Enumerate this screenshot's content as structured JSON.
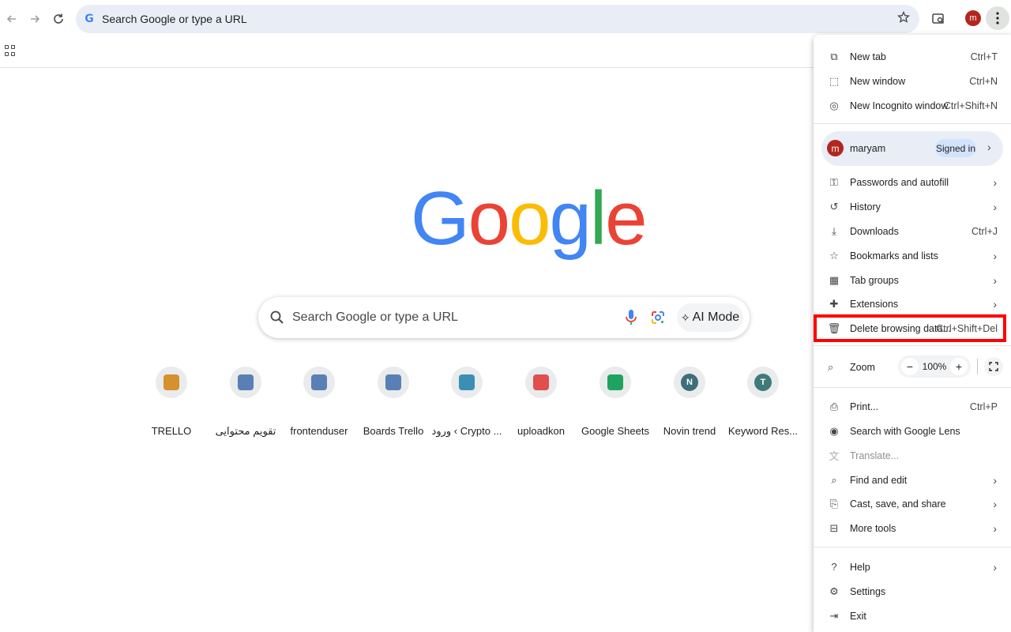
{
  "toolbar": {
    "back_icon": "arrow-left-icon",
    "forward_icon": "arrow-right-icon",
    "reload_icon": "reload-icon",
    "omnibox_text": "Search Google or type a URL",
    "bookmark_star_icon": "star-icon",
    "tab_search_icon": "tab-search-icon",
    "profile_initial": "m",
    "menu_icon": "kebab-icon"
  },
  "newtab": {
    "search_placeholder": "Search Google or type a URL",
    "ai_mode_label": "AI Mode",
    "shortcuts": [
      {
        "label": "TRELLO",
        "color": "#d4912e"
      },
      {
        "label": "تقویم محتوایی",
        "color": "#5a7fb5"
      },
      {
        "label": "frontenduser",
        "color": "#5a7fb5"
      },
      {
        "label": "Boards Trello",
        "color": "#5a7fb5"
      },
      {
        "label": "ورود ‹ Crypto ...",
        "color": "#3b8fb5"
      },
      {
        "label": "uploadkon",
        "color": "#e04e4e"
      },
      {
        "label": "Google Sheets",
        "color": "#1ea362"
      },
      {
        "label": "Novin trend",
        "color": "#3f6d7a",
        "letter": "N"
      },
      {
        "label": "Keyword Res...",
        "color": "#3f7a7a",
        "letter": "T"
      }
    ]
  },
  "menu": {
    "top_items": [
      {
        "label": "New tab",
        "shortcut": "Ctrl+T",
        "icon": "new-tab-icon",
        "glyph": "⧉"
      },
      {
        "label": "New window",
        "shortcut": "Ctrl+N",
        "icon": "new-window-icon",
        "glyph": "⬚"
      },
      {
        "label": "New Incognito window",
        "shortcut": "Ctrl+Shift+N",
        "icon": "incognito-icon",
        "glyph": "◎"
      }
    ],
    "profile": {
      "initial": "m",
      "name": "maryam",
      "status": "Signed in"
    },
    "mid_items": [
      {
        "label": "Passwords and autofill",
        "icon": "key-icon",
        "glyph": "⚿",
        "chevron": true
      },
      {
        "label": "History",
        "icon": "history-icon",
        "glyph": "↺",
        "chevron": true
      },
      {
        "label": "Downloads",
        "shortcut": "Ctrl+J",
        "icon": "download-icon",
        "glyph": "⤓"
      },
      {
        "label": "Bookmarks and lists",
        "icon": "star-icon",
        "glyph": "☆",
        "chevron": true
      },
      {
        "label": "Tab groups",
        "icon": "tab-groups-icon",
        "glyph": "▦",
        "chevron": true
      },
      {
        "label": "Extensions",
        "icon": "puzzle-icon",
        "glyph": "✚",
        "chevron": true
      },
      {
        "label": "Delete browsing data...",
        "shortcut": "Ctrl+Shift+Del",
        "icon": "trash-icon",
        "glyph": "🗑"
      }
    ],
    "zoom": {
      "label": "Zoom",
      "value": "100%",
      "minus": "−",
      "plus": "+"
    },
    "lower_items": [
      {
        "label": "Print...",
        "shortcut": "Ctrl+P",
        "icon": "print-icon",
        "glyph": "⎙"
      },
      {
        "label": "Search with Google Lens",
        "icon": "lens-icon",
        "glyph": "◉"
      },
      {
        "label": "Translate...",
        "icon": "translate-icon",
        "glyph": "文",
        "disabled": true
      },
      {
        "label": "Find and edit",
        "icon": "find-icon",
        "glyph": "⌕",
        "chevron": true
      },
      {
        "label": "Cast, save, and share",
        "icon": "cast-icon",
        "glyph": "⎘",
        "chevron": true
      },
      {
        "label": "More tools",
        "icon": "toolbox-icon",
        "glyph": "⊟",
        "chevron": true
      }
    ],
    "bottom_items": [
      {
        "label": "Help",
        "icon": "help-icon",
        "glyph": "?",
        "chevron": true
      },
      {
        "label": "Settings",
        "icon": "gear-icon",
        "glyph": "⚙"
      },
      {
        "label": "Exit",
        "icon": "exit-icon",
        "glyph": "⇥"
      }
    ]
  },
  "colors": {
    "accent_highlight": "#ff0000",
    "google_blue": "#4285f4",
    "google_red": "#ea4335",
    "google_yellow": "#fbbc05",
    "google_green": "#34a853"
  }
}
